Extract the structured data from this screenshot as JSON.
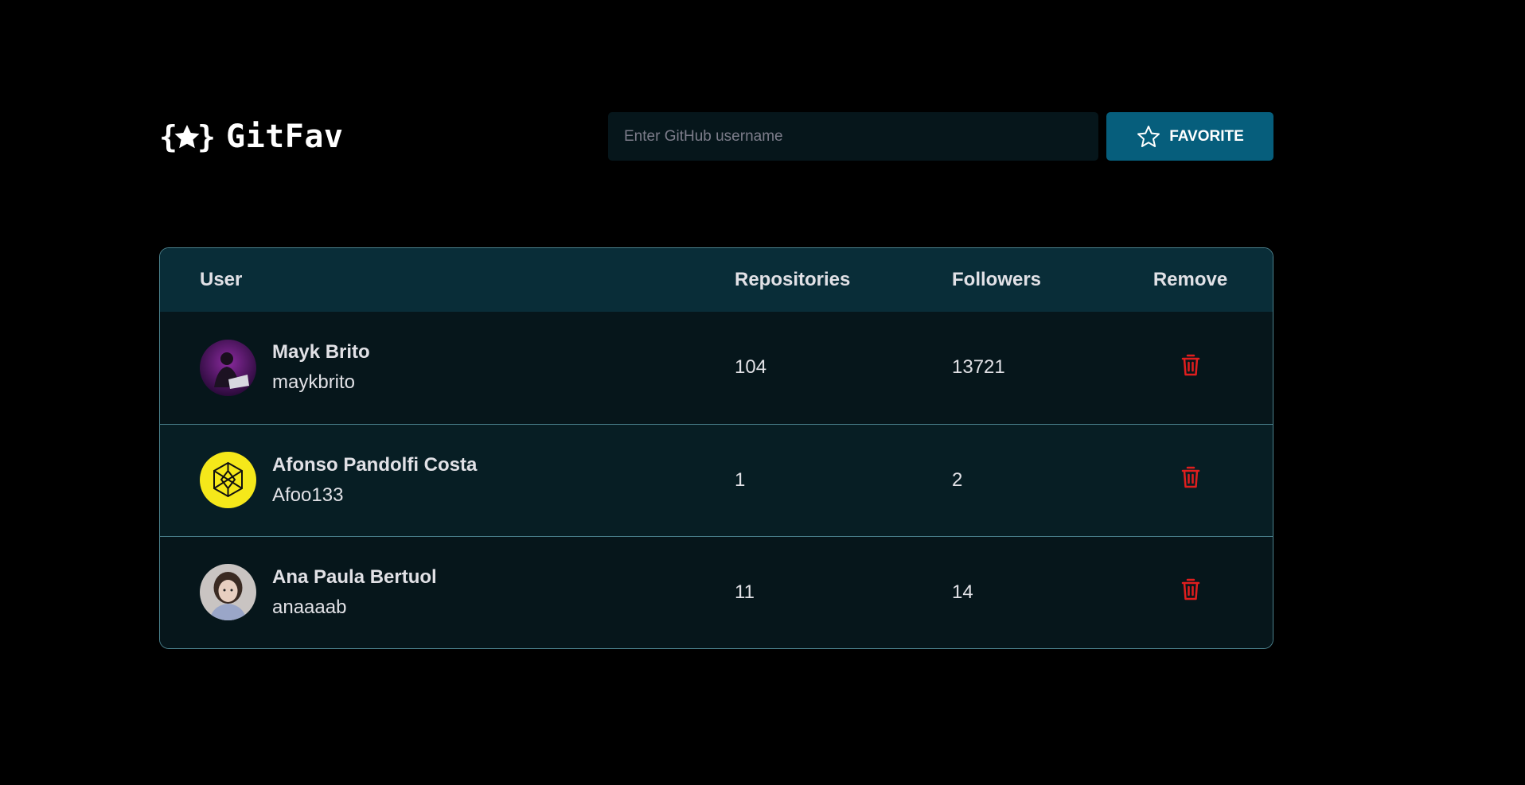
{
  "app": {
    "title": "GitFav"
  },
  "search": {
    "placeholder": "Enter GitHub username",
    "value": "",
    "button_label": "FAVORITE",
    "button_icon": "star-outline-icon"
  },
  "table": {
    "headers": {
      "user": "User",
      "repositories": "Repositories",
      "followers": "Followers",
      "remove": "Remove"
    },
    "rows": [
      {
        "name": "Mayk Brito",
        "login": "maykbrito",
        "repositories": "104",
        "followers": "13721",
        "avatar": "avatar-maykbrito",
        "remove_icon": "trash-icon"
      },
      {
        "name": "Afonso Pandolfi Costa",
        "login": "Afoo133",
        "repositories": "1",
        "followers": "2",
        "avatar": "avatar-afoo133",
        "remove_icon": "trash-icon"
      },
      {
        "name": "Ana Paula Bertuol",
        "login": "anaaaab",
        "repositories": "11",
        "followers": "14",
        "avatar": "avatar-anaaaab",
        "remove_icon": "trash-icon"
      }
    ]
  },
  "colors": {
    "background": "#000000",
    "header_row": "#092D38",
    "button": "#065E7C",
    "input": "#06161B",
    "border": "#4A808C",
    "danger": "#F75A68"
  }
}
